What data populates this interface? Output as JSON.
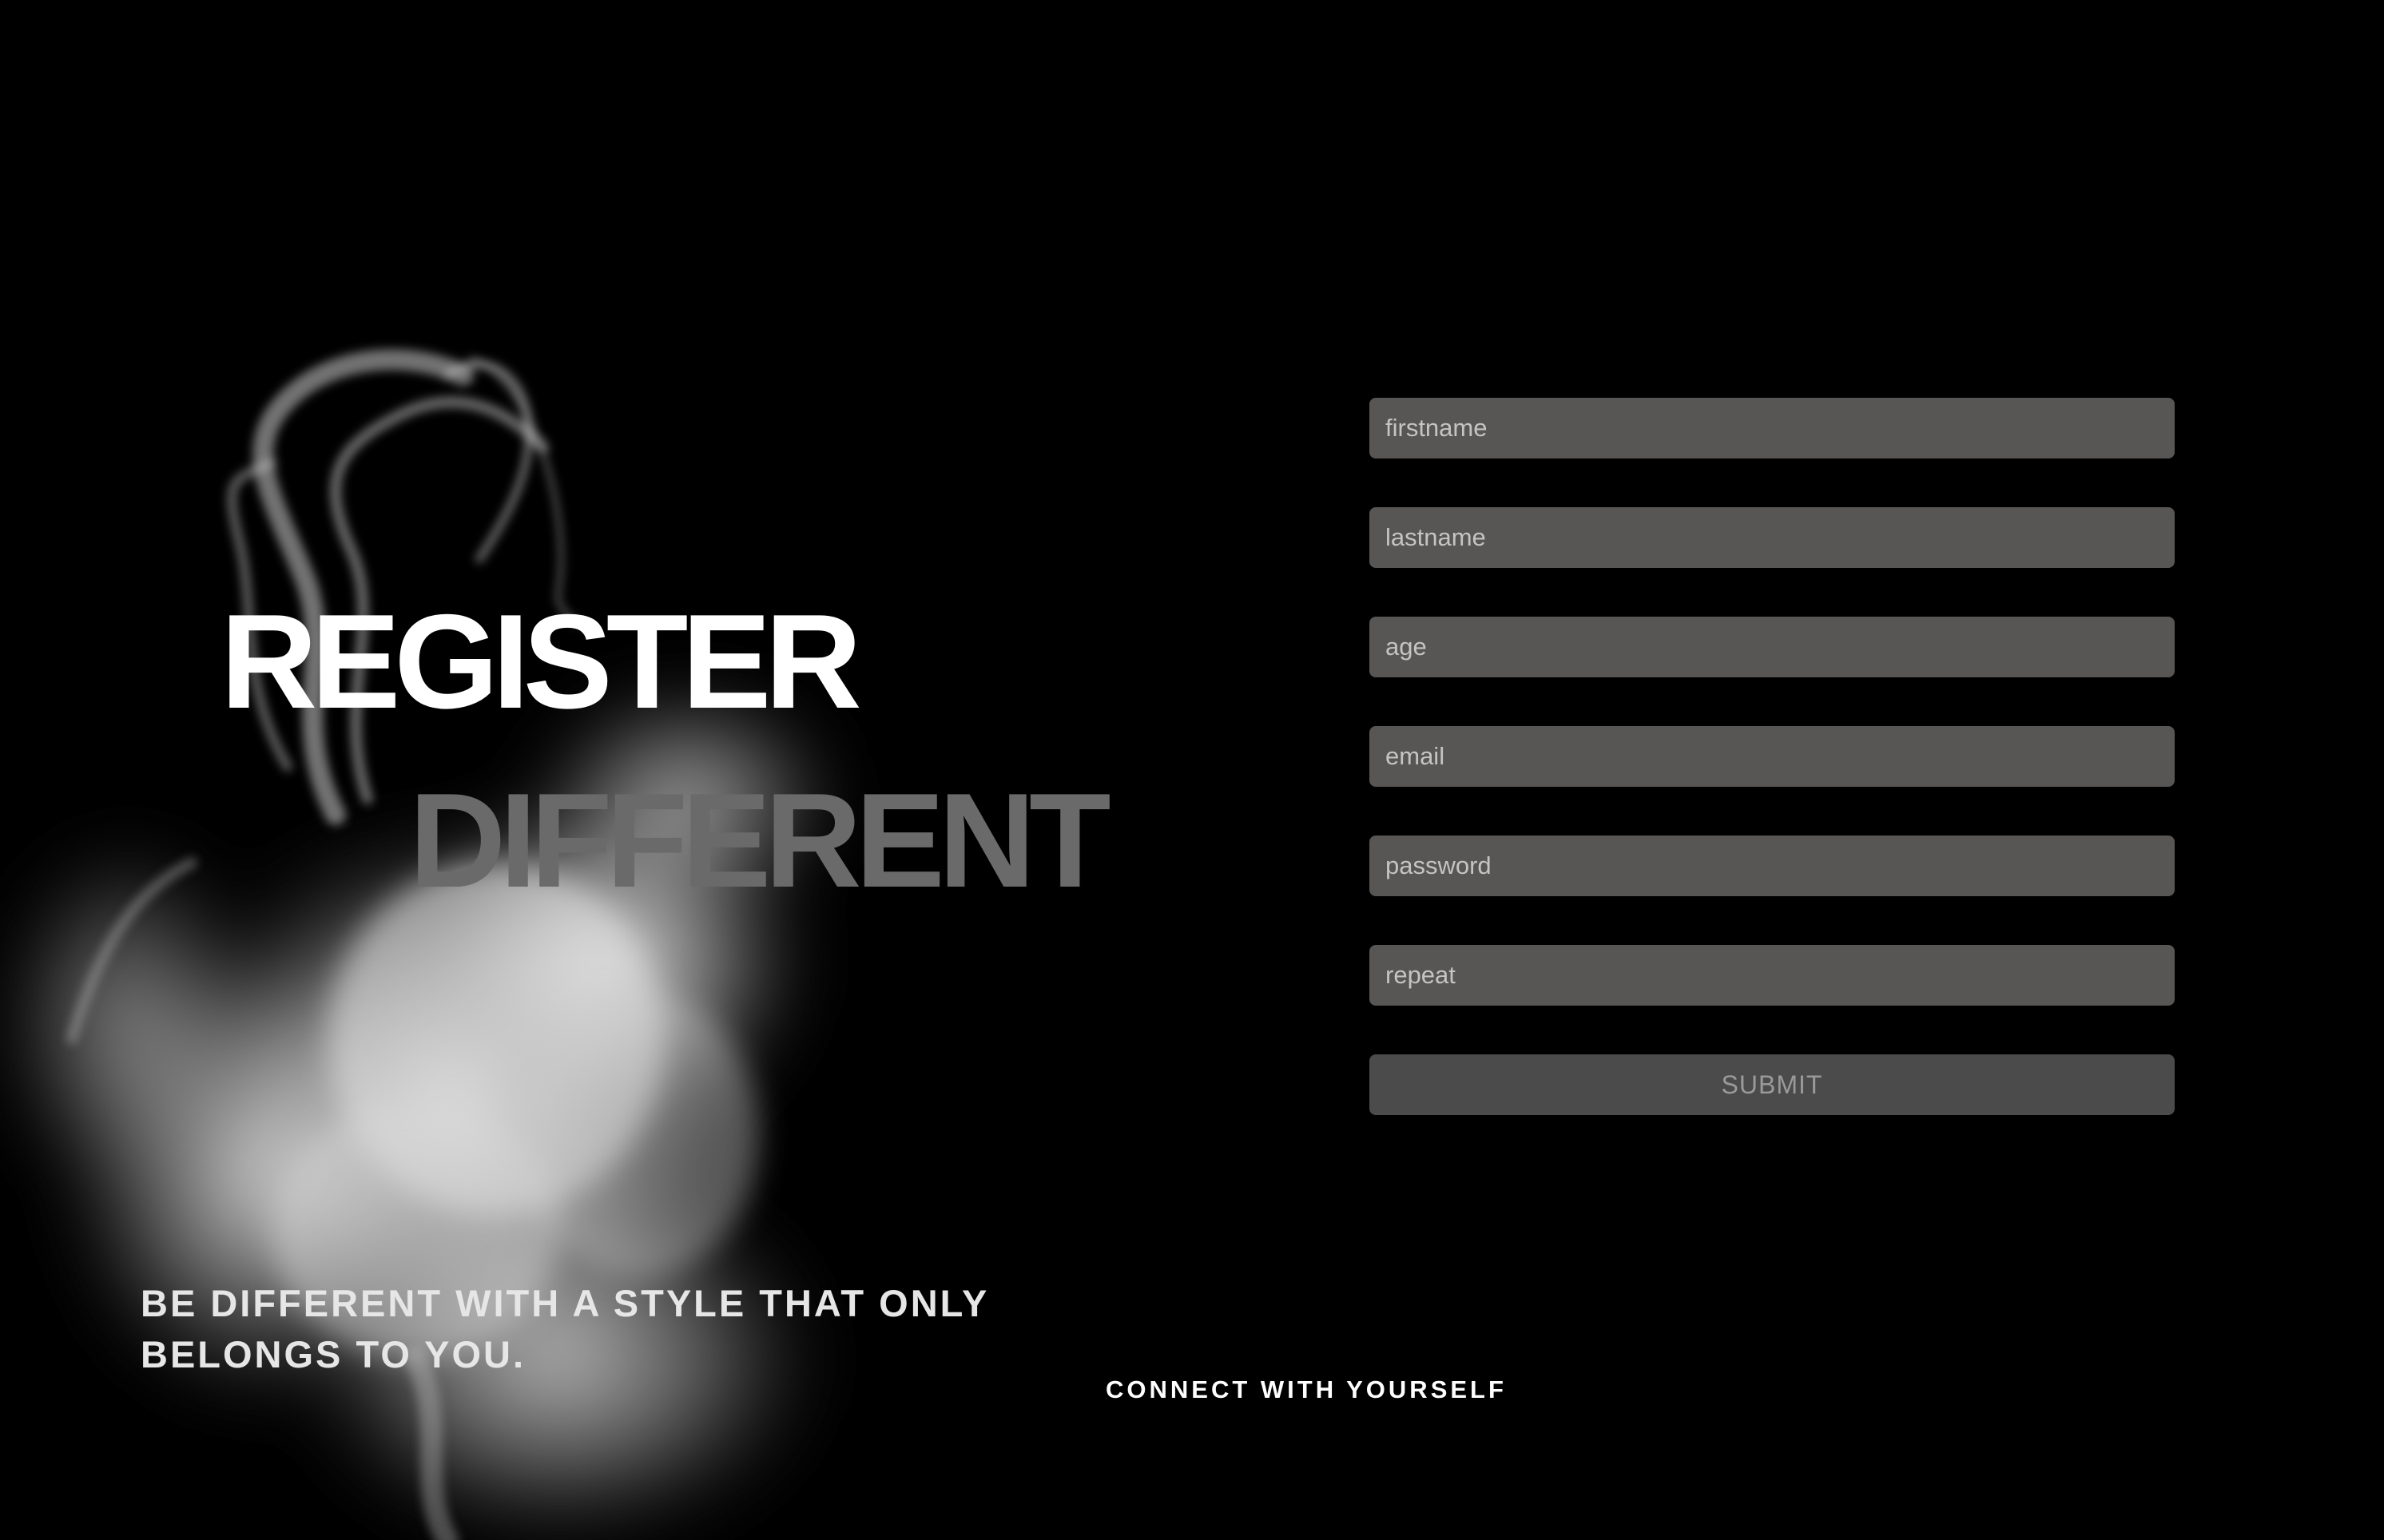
{
  "hero": {
    "title_line1": "REGISTER",
    "title_line2": "DIFFERENT",
    "tagline": "BE DIFFERENT WITH A STYLE THAT ONLY BELONGS TO YOU.",
    "connect": "CONNECT WITH YOURSELF"
  },
  "form": {
    "fields": [
      {
        "name": "firstname",
        "placeholder": "firstname"
      },
      {
        "name": "lastname",
        "placeholder": "lastname"
      },
      {
        "name": "age",
        "placeholder": "age"
      },
      {
        "name": "email",
        "placeholder": "email"
      },
      {
        "name": "password",
        "placeholder": "password"
      },
      {
        "name": "repeat",
        "placeholder": "repeat"
      }
    ],
    "submit_label": "SUBMIT"
  },
  "colors": {
    "background": "#000000",
    "input_background": "#575654",
    "button_background": "#4b4b4b",
    "title_primary": "#ffffff",
    "title_secondary": "#6a6a6a"
  },
  "icons": {
    "background_image": "smoke-illustration"
  }
}
